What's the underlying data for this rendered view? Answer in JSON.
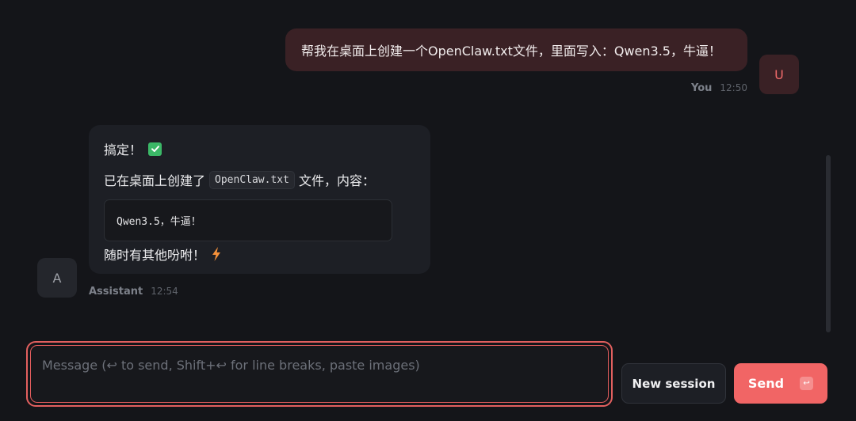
{
  "messages": {
    "user": {
      "text": "帮我在桌面上创建一个OpenClaw.txt文件，里面写入：Qwen3.5，牛逼！",
      "avatar_letter": "U",
      "sender": "You",
      "time": "12:50"
    },
    "assistant": {
      "line1": "搞定！",
      "line2_prefix": "已在桌面上创建了",
      "line2_code": "OpenClaw.txt",
      "line2_suffix": "文件，内容：",
      "code_block": "Qwen3.5，牛逼！",
      "line4": "随时有其他吩咐！",
      "avatar_letter": "A",
      "sender": "Assistant",
      "time": "12:54"
    }
  },
  "composer": {
    "placeholder": "Message (↩ to send, Shift+↩ for line breaks, paste images)",
    "value": ""
  },
  "buttons": {
    "new_session": "New session",
    "send": "Send",
    "send_key_glyph": "↩"
  },
  "icons": {
    "check": "check-mark-icon",
    "bolt": "lightning-bolt-icon"
  },
  "colors": {
    "accent": "#f16565",
    "user_bubble": "#3a2125",
    "check_green": "#3bb867",
    "bolt_orange": "#f5913a"
  }
}
